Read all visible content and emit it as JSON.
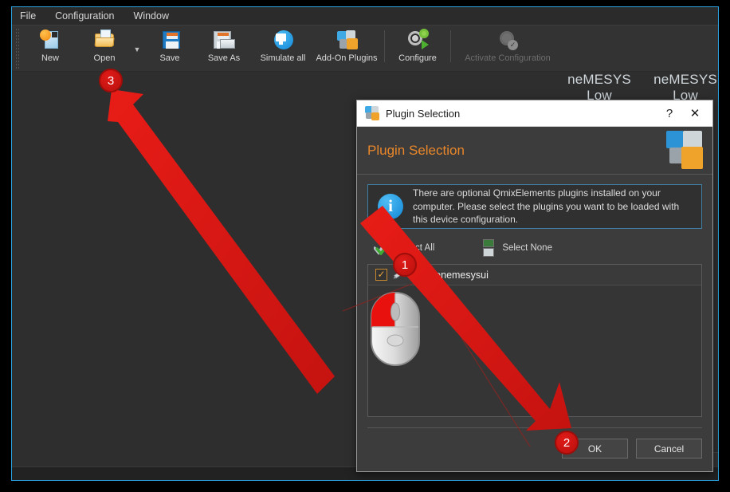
{
  "app": {
    "menu": [
      {
        "label": "File"
      },
      {
        "label": "Configuration"
      },
      {
        "label": "Window"
      }
    ],
    "toolbar": [
      {
        "label": "New",
        "icon": "new-document-icon",
        "enabled": true
      },
      {
        "label": "Open",
        "icon": "open-folder-icon",
        "enabled": true
      },
      {
        "label": "Save",
        "icon": "save-disk-icon",
        "enabled": true
      },
      {
        "label": "Save As",
        "icon": "save-as-icon",
        "enabled": true
      },
      {
        "label": "Simulate all",
        "icon": "monitor-simulate-icon",
        "enabled": true
      },
      {
        "label": "Add-On Plugins",
        "icon": "puzzle-plugins-icon",
        "enabled": true
      },
      {
        "label": "Configure",
        "icon": "gear-play-icon",
        "enabled": true
      },
      {
        "label": "Activate Configuration",
        "icon": "gear-check-icon",
        "enabled": false
      }
    ],
    "workspace": {
      "devices": [
        {
          "title": "neMESYS",
          "subtitle": "Low"
        },
        {
          "title": "neMESYS",
          "subtitle": "Low"
        }
      ]
    }
  },
  "dialog": {
    "titlebar": {
      "icon": "puzzle-piece-icon",
      "title": "Plugin Selection",
      "help_label": "?",
      "close_label": "✕"
    },
    "header": {
      "title": "Plugin Selection",
      "art_icon": "puzzle-pieces-icon"
    },
    "info": {
      "icon": "info-circle-icon",
      "text": "There are optional QmixElements plugins installed on your computer. Please select the plugins you want to be loaded with this device configuration."
    },
    "actions": {
      "select_all": {
        "label": "Select All",
        "icon": "double-check-icon"
      },
      "select_none": {
        "label": "Select None",
        "icon": "empty-checkbox-icon"
      }
    },
    "plugin_list": [
      {
        "name": "simplenemesysui",
        "checked": true,
        "icon": "syringe-pump-icon"
      }
    ],
    "buttons": {
      "ok": "OK",
      "cancel": "Cancel"
    }
  },
  "annotations": {
    "badges": [
      {
        "id": "1",
        "label": "1"
      },
      {
        "id": "2",
        "label": "2"
      },
      {
        "id": "3",
        "label": "3"
      }
    ],
    "accent_color": "#d61a16"
  }
}
